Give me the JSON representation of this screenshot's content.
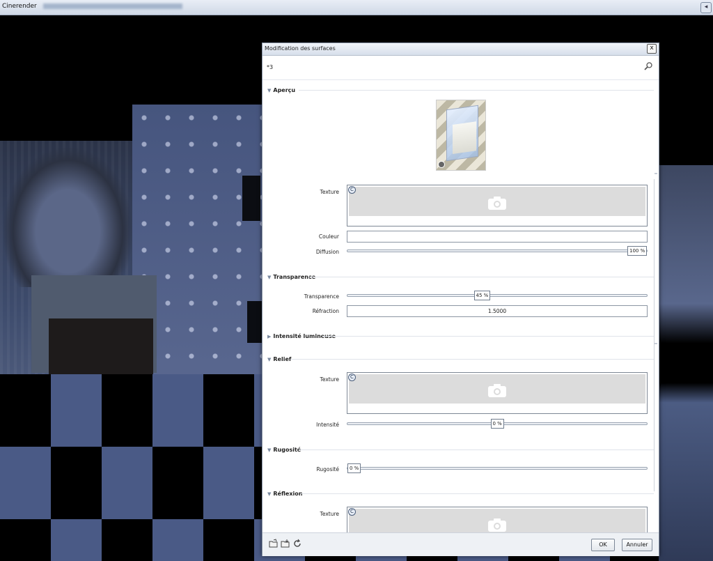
{
  "app": {
    "title": "Cinerender"
  },
  "dialog": {
    "title": "Modification des surfaces",
    "name": "*3",
    "close_label": "x",
    "sections": {
      "apercu": "Aperçu",
      "transparence": "Transparence",
      "intensite": "Intensité lumineuse",
      "relief": "Relief",
      "rugosite": "Rugosité",
      "reflexion": "Réflexion"
    },
    "fields": {
      "texture_label": "Texture",
      "couleur_label": "Couleur",
      "couleur_value": "",
      "diffusion_label": "Diffusion",
      "diffusion_value": "100 %",
      "diffusion_level": 100,
      "transparence_label": "Transparence",
      "transparence_value": "45 %",
      "transparence_level": 45,
      "refraction_label": "Réfraction",
      "refraction_value": "1.5000",
      "relief_texture_label": "Texture",
      "intensite_label": "Intensité",
      "intensite_value": "0 %",
      "intensite_level": 50,
      "rugosite_label": "Rugosité",
      "rugosite_value": "0 %",
      "rugosite_level": 0,
      "reflexion_texture_label": "Texture",
      "texture_button_glyph": "C"
    },
    "buttons": {
      "ok": "OK",
      "cancel": "Annuler"
    },
    "icons": [
      "open-folder-icon",
      "save-folder-icon",
      "reload-icon",
      "search-icon",
      "camera-icon"
    ]
  }
}
